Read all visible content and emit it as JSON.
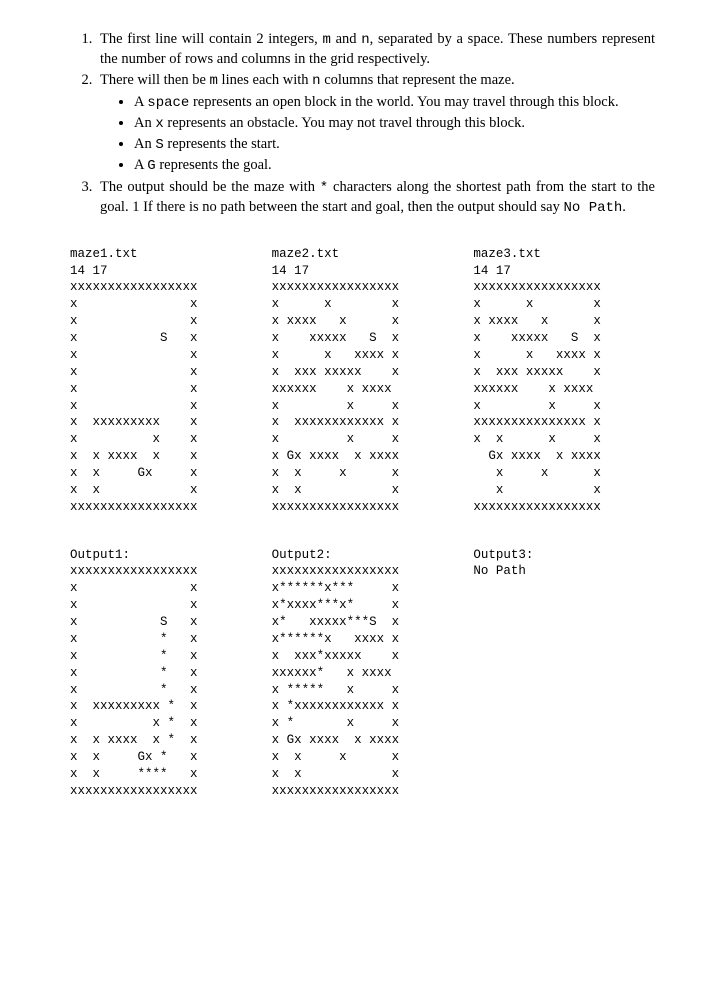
{
  "list": {
    "item1": {
      "pre": "The first line will contain 2 integers, ",
      "code1": "m",
      "mid1": " and ",
      "code2": "n",
      "post": ", separated by a space. These numbers represent the number of rows and columns in the grid respectively."
    },
    "item2": {
      "pre": "There will then be ",
      "code1": "m",
      "mid1": " lines each with ",
      "code2": "n",
      "post": " columns that represent the maze."
    },
    "bullets": {
      "b1_pre": "A ",
      "b1_code": "space",
      "b1_post": " represents an open block in the world. You may travel through this block.",
      "b2_pre": "An ",
      "b2_code": "x",
      "b2_post": " represents an obstacle. You may not travel through this block.",
      "b3_pre": "An ",
      "b3_code": "S",
      "b3_post": " represents the start.",
      "b4_pre": "A ",
      "b4_code": "G",
      "b4_post": " represents the goal."
    },
    "item3": {
      "pre": "The output should be the maze with ",
      "code1": "*",
      "mid1": " characters along the shortest path from the start to the goal. 1 If there is no path between the start and goal, then the output should say ",
      "code2": "No Path",
      "post": "."
    }
  },
  "maze1": {
    "filename": "maze1.txt",
    "dims": "14 17",
    "body": "xxxxxxxxxxxxxxxxx\nx               x\nx               x\nx           S   x\nx               x\nx               x\nx               x\nx               x\nx  xxxxxxxxx    x\nx          x    x\nx  x xxxx  x    x\nx  x     Gx     x\nx  x            x\nxxxxxxxxxxxxxxxxx"
  },
  "maze2": {
    "filename": "maze2.txt",
    "dims": "14 17",
    "body": "xxxxxxxxxxxxxxxxx\nx      x        x\nx xxxx   x      x\nx    xxxxx   S  x\nx      x   xxxx x\nx  xxx xxxxx    x\nxxxxxx    x xxxx\nx         x     x\nx  xxxxxxxxxxxx x\nx         x     x\nx Gx xxxx  x xxxx\nx  x     x      x\nx  x            x\nxxxxxxxxxxxxxxxxx"
  },
  "maze3": {
    "filename": "maze3.txt",
    "dims": "14 17",
    "body": "xxxxxxxxxxxxxxxxx\nx      x        x\nx xxxx   x      x\nx    xxxxx   S  x\nx      x   xxxx x\nx  xxx xxxxx    x\nxxxxxx    x xxxx\nx         x     x\nxxxxxxxxxxxxxxx x\nx  x      x     x\n  Gx xxxx  x xxxx\n   x     x      x\n   x            x\nxxxxxxxxxxxxxxxxx"
  },
  "out1": {
    "label": "Output1:",
    "body": "xxxxxxxxxxxxxxxxx\nx               x\nx               x\nx           S   x\nx           *   x\nx           *   x\nx           *   x\nx           *   x\nx  xxxxxxxxx *  x\nx          x *  x\nx  x xxxx  x *  x\nx  x     Gx *   x\nx  x     ****   x\nxxxxxxxxxxxxxxxxx"
  },
  "out2": {
    "label": "Output2:",
    "body": "xxxxxxxxxxxxxxxxx\nx******x***     x\nx*xxxx***x*     x\nx*   xxxxx***S  x\nx******x   xxxx x\nx  xxx*xxxxx    x\nxxxxxx*   x xxxx\nx *****   x     x\nx *xxxxxxxxxxxx x\nx *       x     x\nx Gx xxxx  x xxxx\nx  x     x      x\nx  x            x\nxxxxxxxxxxxxxxxxx"
  },
  "out3": {
    "label": "Output3:",
    "body": "No Path"
  }
}
